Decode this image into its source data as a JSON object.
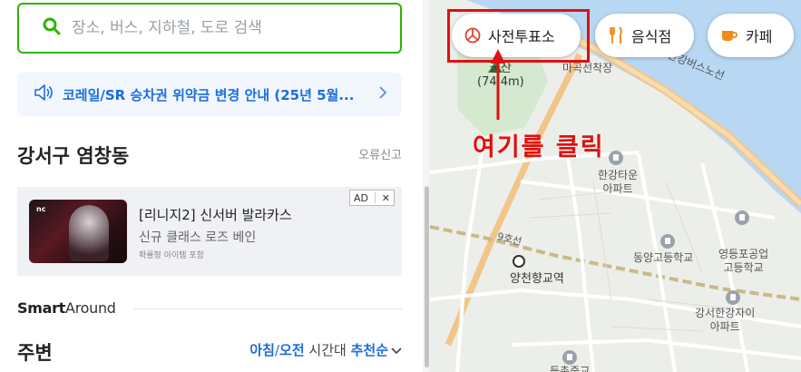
{
  "search": {
    "placeholder": "장소, 버스, 지하철, 도로 검색"
  },
  "notice": {
    "text": "코레일/SR 승차권 위약금 변경 안내 (25년 5월..."
  },
  "region": {
    "title": "강서구 염창동",
    "report_label": "오류신고"
  },
  "ad": {
    "badge": "AD",
    "close": "✕",
    "thumb_brand": "nc",
    "title": "[리니지2] 신서버 발라카스",
    "subtitle": "신규 클래스 로즈 베인",
    "note": "확률형 아이템 포함"
  },
  "smart_around": {
    "bold": "Smart",
    "rest": "Around"
  },
  "nearby": {
    "title": "주변",
    "time_morning": "아침",
    "slash": "/",
    "time_am": "오전",
    "time_suffix": " 시간대 ",
    "sort": "추천순"
  },
  "map": {
    "chips": [
      {
        "label": "사전투표소",
        "icon": "vote-icon"
      },
      {
        "label": "음식점",
        "icon": "fork-knife-icon"
      },
      {
        "label": "카페",
        "icon": "coffee-cup-icon"
      }
    ],
    "labels": {
      "mountain_name": "궁산",
      "mountain_height": "(74.4m)",
      "park_station": "마곡선착장",
      "river_road": "한강버스노선",
      "apt_hangang_1": "한강타운",
      "apt_hangang_2": "아파트",
      "line9": "9호선",
      "school1": "동양고등학교",
      "school2_1": "영등포공업",
      "school2_2": "고등학교",
      "station": "양천향교역",
      "apt_gangseo_1": "강서한강자이",
      "apt_gangseo_2": "아파트",
      "bottom_cut": "등촌중교"
    },
    "annotation": "여기를 클릭",
    "colors": {
      "highlight": "#e01010",
      "water": "#b8d7f2",
      "park": "#d4e9cf",
      "road": "#f5c98c"
    }
  },
  "colors": {
    "accent_green": "#2db400",
    "link_blue": "#1d6ce0"
  }
}
